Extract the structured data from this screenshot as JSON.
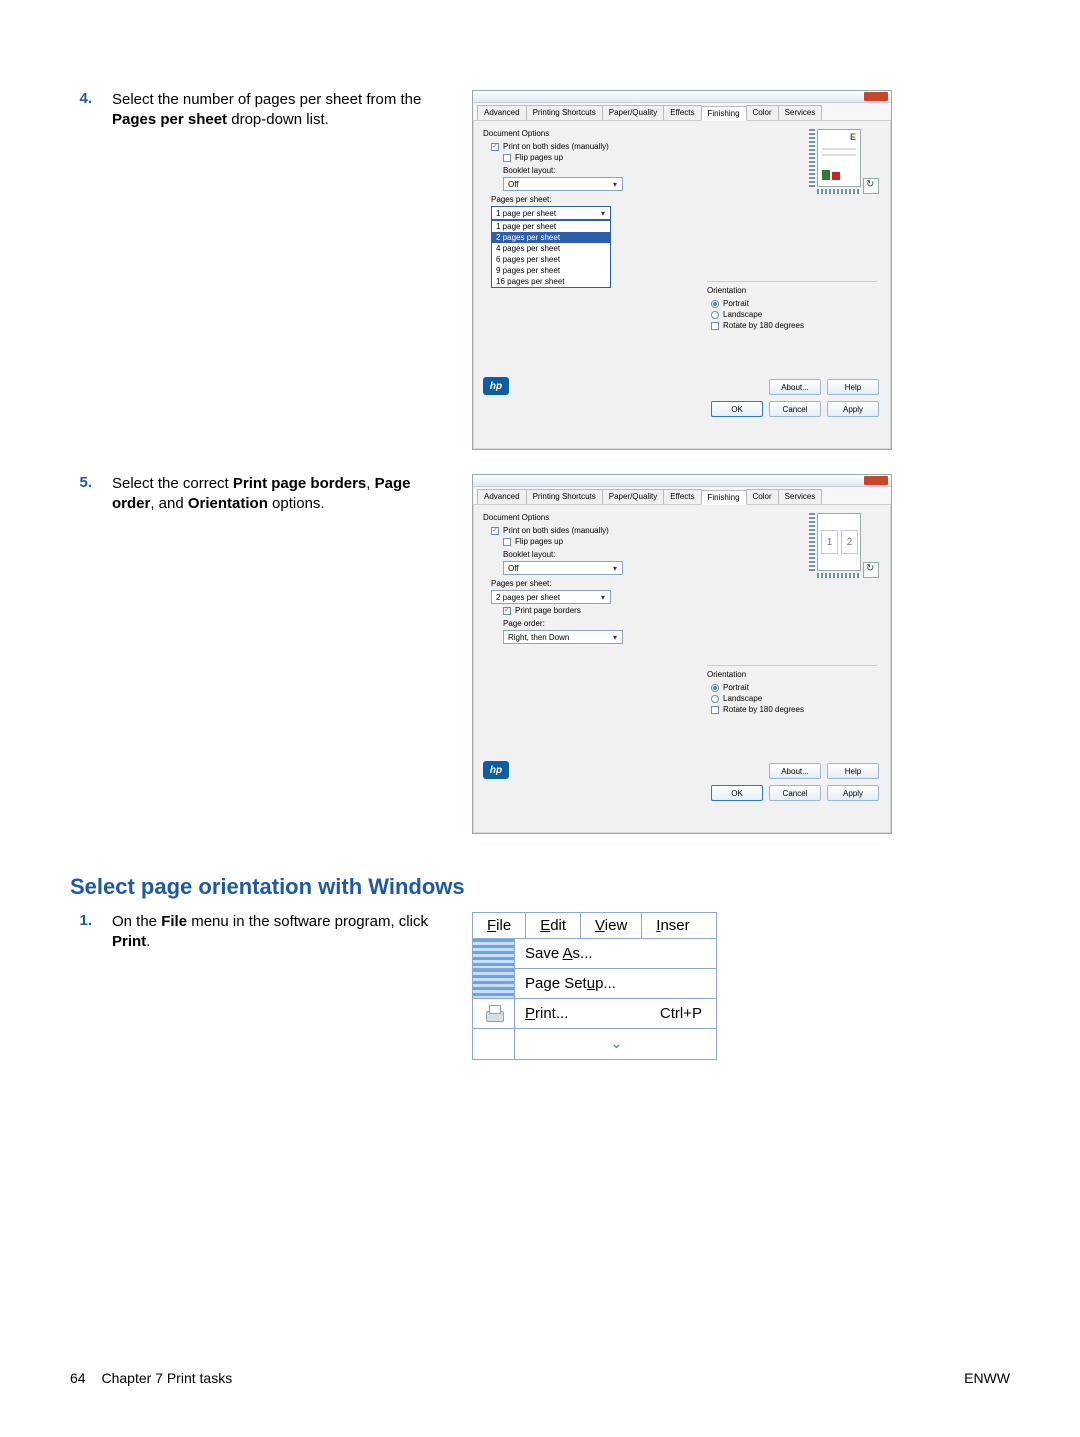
{
  "step4": {
    "num": "4.",
    "pre": "Select the number of pages per sheet from the ",
    "bold": "Pages per sheet",
    "post": " drop-down list."
  },
  "step5": {
    "num": "5.",
    "pre": "Select the correct ",
    "b1": "Print page borders",
    "sep1": ", ",
    "b2": "Page order",
    "sep2": ", and ",
    "b3": "Orientation",
    "post": " options."
  },
  "heading": "Select page orientation with Windows",
  "step1": {
    "num": "1.",
    "pre": "On the ",
    "b1": "File",
    "mid": " menu in the software program, click ",
    "b2": "Print",
    "post": "."
  },
  "dialog": {
    "tabs": [
      "Advanced",
      "Printing Shortcuts",
      "Paper/Quality",
      "Effects",
      "Finishing",
      "Color",
      "Services"
    ],
    "doc_options": "Document Options",
    "print_both": "Print on both sides (manually)",
    "flip_up": "Flip pages up",
    "booklet": "Booklet layout:",
    "booklet_val": "Off",
    "pps_label": "Pages per sheet:",
    "pps_sel_a": "1 page per sheet",
    "pps_list": [
      "1 page per sheet",
      "2 pages per sheet",
      "4 pages per sheet",
      "6 pages per sheet",
      "9 pages per sheet",
      "16 pages per sheet"
    ],
    "pps_sel_b": "2 pages per sheet",
    "print_borders": "Print page borders",
    "page_order": "Page order:",
    "page_order_val": "Right, then Down",
    "orientation": "Orientation",
    "portrait": "Portrait",
    "landscape": "Landscape",
    "rotate": "Rotate by 180 degrees",
    "about": "About...",
    "help": "Help",
    "ok": "OK",
    "cancel": "Cancel",
    "apply": "Apply",
    "hp": "hp"
  },
  "filemenu": {
    "items": [
      "File",
      "Edit",
      "View",
      "Inser"
    ],
    "save_as": "Save As...",
    "page_setup": "Page Setup...",
    "print": "Print...",
    "accel": "Ctrl+P"
  },
  "footer": {
    "page": "64",
    "chapter": "Chapter 7   Print tasks",
    "right": "ENWW"
  }
}
